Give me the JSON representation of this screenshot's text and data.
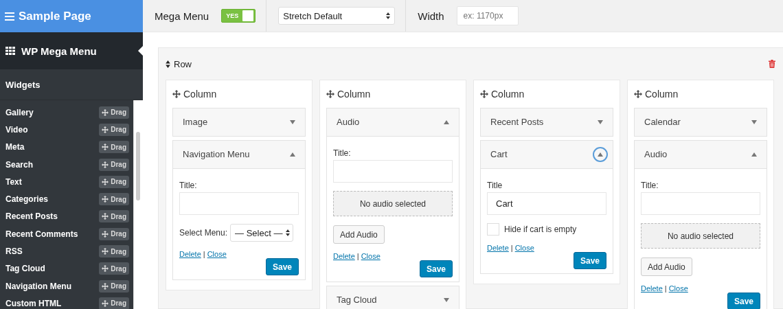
{
  "header": {
    "title": "Sample Page"
  },
  "toolbar": {
    "label": "Mega Menu",
    "toggle": {
      "label": "YES",
      "on": true
    },
    "stretch_select": {
      "value": "Stretch Default"
    },
    "width": {
      "label": "Width",
      "placeholder": "ex: 1170px"
    }
  },
  "sidebar": {
    "title": "WP Mega Menu",
    "section": "Widgets",
    "items": [
      {
        "name": "Gallery",
        "drag": "Drag"
      },
      {
        "name": "Video",
        "drag": "Drag"
      },
      {
        "name": "Meta",
        "drag": "Drag"
      },
      {
        "name": "Search",
        "drag": "Drag"
      },
      {
        "name": "Text",
        "drag": "Drag"
      },
      {
        "name": "Categories",
        "drag": "Drag"
      },
      {
        "name": "Recent Posts",
        "drag": "Drag"
      },
      {
        "name": "Recent Comments",
        "drag": "Drag"
      },
      {
        "name": "RSS",
        "drag": "Drag"
      },
      {
        "name": "Tag Cloud",
        "drag": "Drag"
      },
      {
        "name": "Navigation Menu",
        "drag": "Drag"
      },
      {
        "name": "Custom HTML",
        "drag": "Drag"
      }
    ]
  },
  "row": {
    "label": "Row",
    "columns": [
      {
        "label": "Column",
        "widgets": [
          {
            "title": "Image",
            "expanded": false,
            "focused": false
          },
          {
            "title": "Navigation Menu",
            "expanded": true,
            "focused": false,
            "kind": "menu",
            "form": {
              "title_label": "Title:",
              "select_label": "Select Menu:",
              "select_value": "— Select —",
              "delete": "Delete",
              "separator": "|",
              "close": "Close",
              "save": "Save"
            }
          }
        ]
      },
      {
        "label": "Column",
        "widgets": [
          {
            "title": "Audio",
            "expanded": true,
            "focused": false,
            "kind": "audio",
            "form": {
              "title_label": "Title:",
              "media_status": "No audio selected",
              "add_button": "Add Audio",
              "delete": "Delete",
              "separator": "|",
              "close": "Close",
              "save": "Save"
            }
          },
          {
            "title": "Tag Cloud",
            "expanded": false,
            "focused": false
          }
        ]
      },
      {
        "label": "Column",
        "widgets": [
          {
            "title": "Recent Posts",
            "expanded": false,
            "focused": false
          },
          {
            "title": "Cart",
            "expanded": true,
            "focused": true,
            "kind": "cart",
            "form": {
              "title_label": "Title",
              "title_value": "Cart",
              "checkbox_label": "Hide if cart is empty",
              "checked": false,
              "delete": "Delete",
              "separator": "|",
              "close": "Close",
              "save": "Save"
            }
          }
        ]
      },
      {
        "label": "Column",
        "widgets": [
          {
            "title": "Calendar",
            "expanded": false,
            "focused": false
          },
          {
            "title": "Audio",
            "expanded": true,
            "focused": false,
            "kind": "audio",
            "form": {
              "title_label": "Title:",
              "media_status": "No audio selected",
              "add_button": "Add Audio",
              "delete": "Delete",
              "separator": "|",
              "close": "Close",
              "save": "Save"
            }
          }
        ]
      }
    ]
  }
}
